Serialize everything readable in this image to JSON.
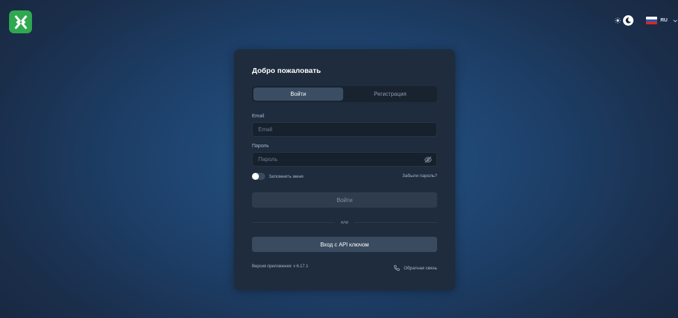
{
  "header": {
    "logo_icon": "app-logo-icon",
    "theme": {
      "light_icon": "sun-icon",
      "dark_icon": "moon-icon"
    },
    "language": {
      "code": "RU",
      "flag_icon": "russia-flag-icon"
    }
  },
  "login": {
    "title": "Добро пожаловать",
    "tabs": [
      {
        "label": "Войти",
        "active": true
      },
      {
        "label": "Регистрация",
        "active": false
      }
    ],
    "email": {
      "label": "Email",
      "placeholder": "Email",
      "value": ""
    },
    "password": {
      "label": "Пароль",
      "placeholder": "Пароль",
      "value": "",
      "toggle_icon": "eye-off-icon"
    },
    "remember_me": {
      "label": "Запомнить меня",
      "checked": false
    },
    "forgot_password": "Забыли пароль?",
    "submit_label": "Войти",
    "divider": "или",
    "api_key_label": "Вход с API ключом",
    "version": "Версия приложения: v 6.17.1",
    "feedback": {
      "label": "Обратная связь",
      "icon": "phone-icon"
    }
  },
  "colors": {
    "brand_green": "#2fa84f",
    "card_bg": "#1e2c3d",
    "accent_button": "#3a4b60"
  }
}
